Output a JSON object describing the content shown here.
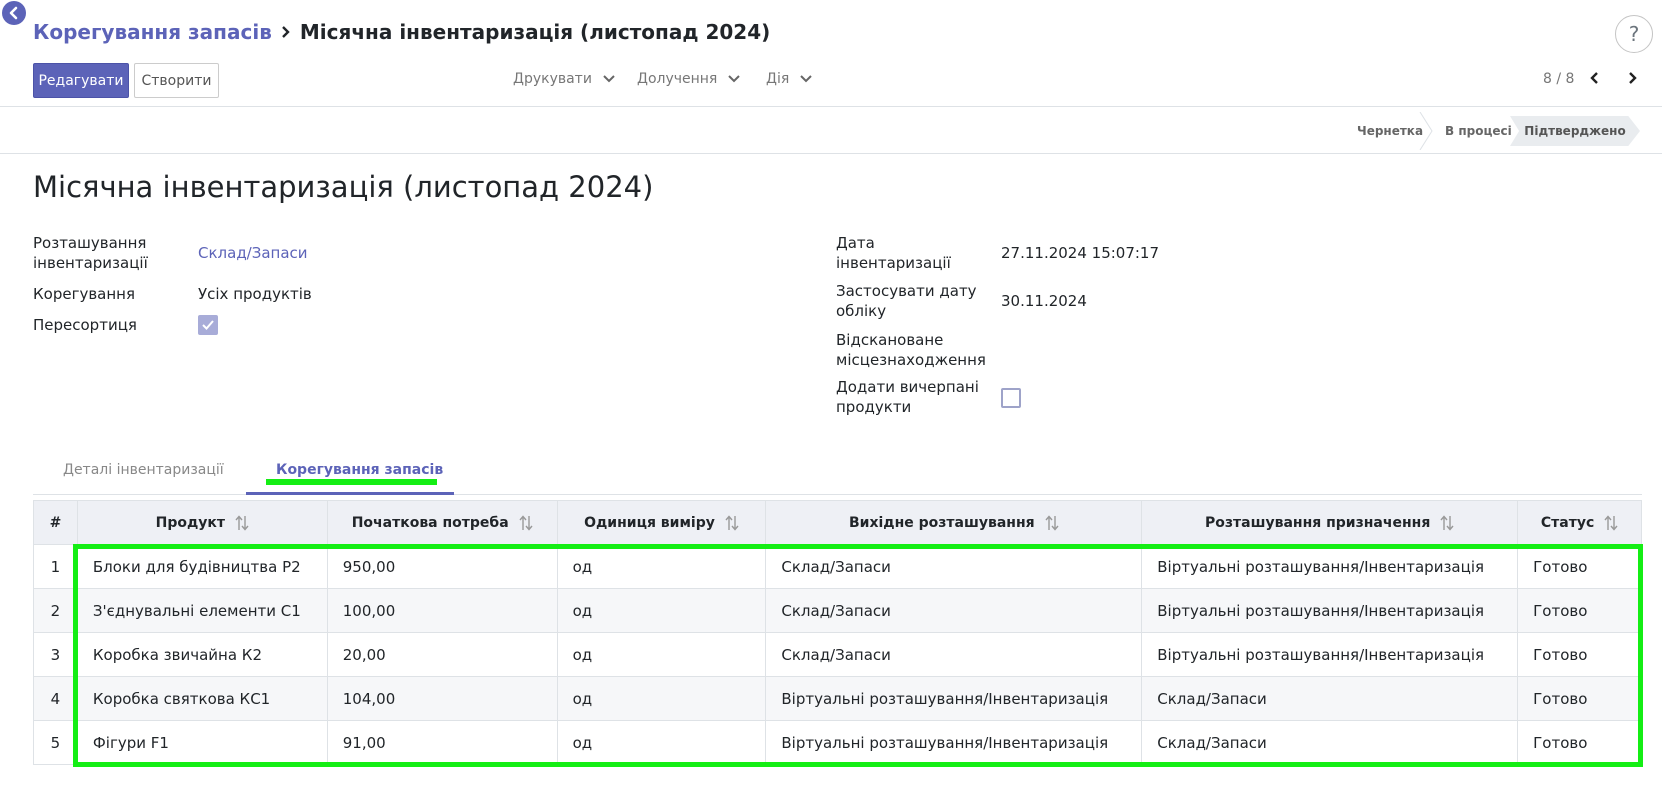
{
  "breadcrumb": {
    "parent": "Корегування запасів",
    "current": "Місячна інвентаризація (листопад 2024)"
  },
  "help": {
    "label": "?"
  },
  "toolbar": {
    "edit_label": "Редагувати",
    "create_label": "Створити",
    "print_label": "Друкувати",
    "attach_label": "Долучення",
    "action_label": "Дія"
  },
  "pager": {
    "label": "8 / 8"
  },
  "status_stages": [
    "Чернетка",
    "В процесі",
    "Підтверджено"
  ],
  "record": {
    "title": "Місячна інвентаризація (листопад 2024)",
    "location_label": "Розташування інвентаризації",
    "location_value": "Склад/Запаси",
    "adjustment_label": "Корегування",
    "adjustment_value": "Усіх продуктів",
    "resorting_label": "Пересортиця",
    "resorting_checked": true,
    "inventory_date_label": "Дата інвентаризації",
    "inventory_date_value": "27.11.2024 15:07:17",
    "accounting_date_label": "Застосувати дату обліку",
    "accounting_date_value": "30.11.2024",
    "scanned_location_label": "Відскановане місцезнаходження",
    "add_exhausted_label": "Додати вичерпані продукти",
    "add_exhausted_checked": false
  },
  "tabs": {
    "details": "Деталі інвентаризації",
    "adjustments": "Корегування запасів"
  },
  "table": {
    "headers": {
      "num": "#",
      "product": "Продукт",
      "initial_demand": "Початкова потреба",
      "uom": "Одиниця виміру",
      "source": "Вихідне розташування",
      "destination": "Розташування призначення",
      "status": "Статус"
    },
    "rows": [
      {
        "num": "1",
        "product": "Блоки для будівництва Р2",
        "qty": "950,00",
        "uom": "од",
        "source": "Склад/Запаси",
        "destination": "Віртуальні розташування/Інвентаризація",
        "status": "Готово"
      },
      {
        "num": "2",
        "product": "З'єднувальні елементи С1",
        "qty": "100,00",
        "uom": "од",
        "source": "Склад/Запаси",
        "destination": "Віртуальні розташування/Інвентаризація",
        "status": "Готово"
      },
      {
        "num": "3",
        "product": "Коробка звичайна К2",
        "qty": "20,00",
        "uom": "од",
        "source": "Склад/Запаси",
        "destination": "Віртуальні розташування/Інвентаризація",
        "status": "Готово"
      },
      {
        "num": "4",
        "product": "Коробка святкова КС1",
        "qty": "104,00",
        "uom": "од",
        "source": "Віртуальні розташування/Інвентаризація",
        "destination": "Склад/Запаси",
        "status": "Готово"
      },
      {
        "num": "5",
        "product": "Фігури F1",
        "qty": "91,00",
        "uom": "од",
        "source": "Віртуальні розташування/Інвентаризація",
        "destination": "Склад/Запаси",
        "status": "Готово"
      }
    ]
  },
  "colors": {
    "accent": "#5c63b8",
    "highlight": "#14ee14"
  }
}
